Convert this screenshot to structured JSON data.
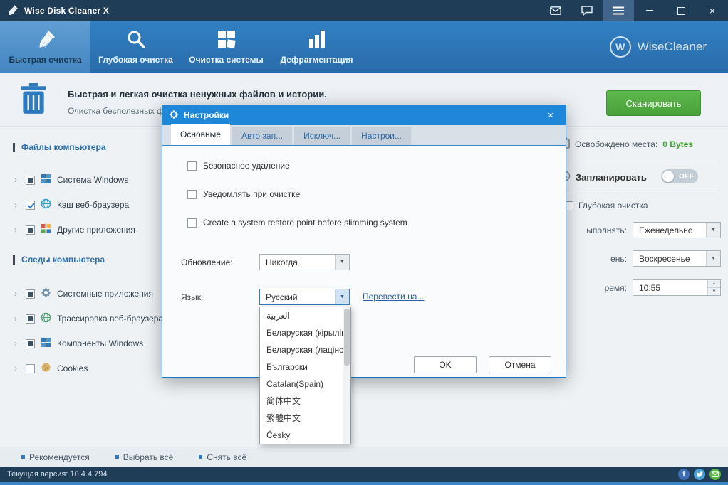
{
  "titlebar": {
    "title": "Wise Disk Cleaner X"
  },
  "nav": {
    "tabs": [
      {
        "label": "Быстрая очистка",
        "state": "active"
      },
      {
        "label": "Глубокая очистка",
        "state": "normal"
      },
      {
        "label": "Очистка системы",
        "state": "normal"
      },
      {
        "label": "Дефрагментация",
        "state": "normal"
      }
    ],
    "brand": "WiseCleaner",
    "brand_letter": "W"
  },
  "header": {
    "title": "Быстрая и легкая очистка ненужных файлов и истории.",
    "subtitle": "Очистка бесполезных фа",
    "scan_button": "Сканировать"
  },
  "sidebar": {
    "sections": [
      {
        "title": "Файлы компьютера",
        "items": [
          {
            "label": "Система Windows",
            "state": "partial"
          },
          {
            "label": "Кэш веб-браузера",
            "state": "checked"
          },
          {
            "label": "Другие приложения",
            "state": "partial"
          }
        ]
      },
      {
        "title": "Следы компьютера",
        "items": [
          {
            "label": "Системные приложения",
            "state": "partial"
          },
          {
            "label": "Трассировка веб-браузера",
            "state": "partial"
          },
          {
            "label": "Компоненты Windows",
            "state": "partial"
          },
          {
            "label": "Cookies",
            "state": "unchecked"
          }
        ]
      }
    ]
  },
  "panel": {
    "freed_label": "Освобождено места:",
    "freed_value": "0 Bytes",
    "schedule_label": "Запланировать",
    "toggle_label": "OFF",
    "toggle_state": "off",
    "deep_clean": "Глубокая очистка",
    "deep_clean_state": "unchecked",
    "run_label": "ыполнять:",
    "run_value": "Еженедельно",
    "day_label": "ень:",
    "day_value": "Воскресенье",
    "time_label": "ремя:",
    "time_value": "10:55"
  },
  "dialog": {
    "title": "Настройки",
    "tabs": [
      "Основные",
      "Авто зап...",
      "Исключ...",
      "Настрои..."
    ],
    "active_tab": "Основные",
    "checkboxes": [
      "Безопасное удаление",
      "Уведомлять при очистке",
      "Create a system restore point before slimming system"
    ],
    "update_label": "Обновление:",
    "update_value": "Никогда",
    "language_label": "Язык:",
    "language_value": "Русский",
    "translate_link": "Перевести на...",
    "language_options": [
      "العربية",
      "Беларуская (кірыліца)",
      "Беларуская (лацінскі)",
      "Български",
      "Catalan(Spain)",
      "简体中文",
      "繁體中文",
      "Česky"
    ],
    "ok_button": "OK",
    "cancel_button": "Отмена"
  },
  "footer": {
    "links": [
      "Рекомендуется",
      "Выбрать всё",
      "Снять всё"
    ]
  },
  "statusbar": {
    "version": "Текущая версия: 10.4.4.794"
  },
  "icons": {
    "close": "×",
    "chevron_right": "›",
    "dropdown_arrow": "▼",
    "spin_up": "▲",
    "spin_down": "▼",
    "facebook": "f"
  },
  "colors": {
    "accent_blue": "#2d7abf",
    "dialog_blue": "#1e87d8",
    "green_button": "#48a139",
    "freed_green": "#3da22f",
    "titlebar_navy": "#203d58"
  }
}
